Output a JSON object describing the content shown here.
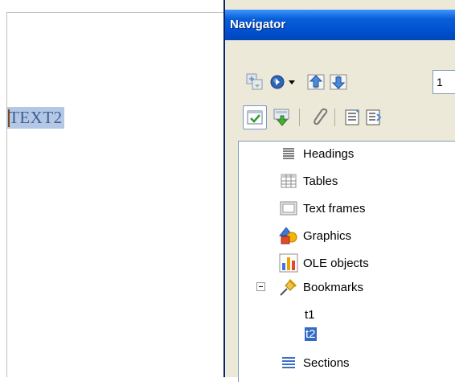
{
  "document": {
    "selected_text": "TEXT2"
  },
  "navigator": {
    "title": "Navigator",
    "page_number": "1",
    "toolbar": {
      "row1": [
        "toggle-icon",
        "navigation-icon",
        "dropdown-arrow-icon",
        "previous-icon",
        "next-icon"
      ],
      "row2": [
        "content-view-icon",
        "promote-level-icon",
        "drag-mode-icon",
        "headings-list-icon",
        "move-heading-icon"
      ]
    },
    "tree": {
      "items": [
        {
          "label": "Headings",
          "icon": "headings-icon"
        },
        {
          "label": "Tables",
          "icon": "table-icon"
        },
        {
          "label": "Text frames",
          "icon": "text-frame-icon"
        },
        {
          "label": "Graphics",
          "icon": "graphics-icon"
        },
        {
          "label": "OLE objects",
          "icon": "ole-objects-icon"
        },
        {
          "label": "Bookmarks",
          "icon": "bookmark-pin-icon",
          "expanded": true,
          "children": [
            {
              "label": "t1",
              "selected": false
            },
            {
              "label": "t2",
              "selected": true
            }
          ]
        },
        {
          "label": "Sections",
          "icon": "sections-icon"
        }
      ]
    }
  },
  "colors": {
    "titlebar": "#0050d0",
    "selection_doc": "#b4c8e6",
    "selection_tree": "#316ac5",
    "window_bg": "#ece9d8"
  }
}
